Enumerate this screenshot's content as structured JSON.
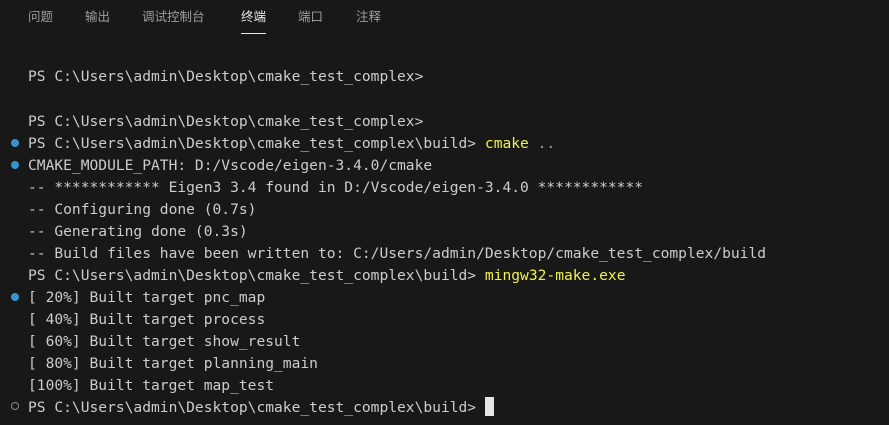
{
  "tabs": [
    {
      "label": "问题",
      "active": false
    },
    {
      "label": "输出",
      "active": false
    },
    {
      "label": "调试控制台",
      "active": false
    },
    {
      "label": "终端",
      "active": true
    },
    {
      "label": "端口",
      "active": false
    },
    {
      "label": "注释",
      "active": false
    }
  ],
  "terminal": {
    "prompt1": "PS C:\\Users\\admin\\Desktop\\cmake_test_complex>",
    "prompt2": "PS C:\\Users\\admin\\Desktop\\cmake_test_complex>",
    "prompt3": "PS C:\\Users\\admin\\Desktop\\cmake_test_complex\\build>",
    "cmd3": "cmake",
    "cmd3_args": "..",
    "out1": "CMAKE_MODULE_PATH: D:/Vscode/eigen-3.4.0/cmake",
    "out2": "-- ************ Eigen3 3.4 found in D:/Vscode/eigen-3.4.0 ************",
    "out3": "-- Configuring done (0.7s)",
    "out4": "-- Generating done (0.3s)",
    "out5": "-- Build files have been written to: C:/Users/admin/Desktop/cmake_test_complex/build",
    "prompt4": "PS C:\\Users\\admin\\Desktop\\cmake_test_complex\\build>",
    "cmd4": "mingw32-make.exe",
    "build1": "[ 20%] Built target pnc_map",
    "build2": "[ 40%] Built target process",
    "build3": "[ 60%] Built target show_result",
    "build4": "[ 80%] Built target planning_main",
    "build5": "[100%] Built target map_test",
    "prompt5": "PS C:\\Users\\admin\\Desktop\\cmake_test_complex\\build>"
  },
  "colors": {
    "background": "#181818",
    "command": "#f1f14c",
    "marker_success": "#3794d1",
    "text": "#cccccc"
  }
}
